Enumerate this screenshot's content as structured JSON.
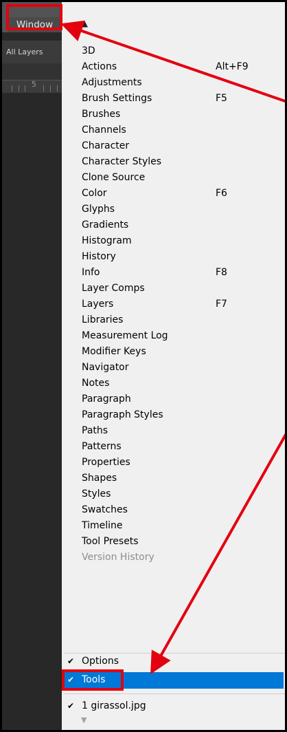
{
  "app": {
    "menubar_item": "Window",
    "layers_label": "All Layers",
    "ruler_number": "5"
  },
  "menu": {
    "items": [
      {
        "label": "3D",
        "shortcut": ""
      },
      {
        "label": "Actions",
        "shortcut": "Alt+F9"
      },
      {
        "label": "Adjustments",
        "shortcut": ""
      },
      {
        "label": "Brush Settings",
        "shortcut": "F5"
      },
      {
        "label": "Brushes",
        "shortcut": ""
      },
      {
        "label": "Channels",
        "shortcut": ""
      },
      {
        "label": "Character",
        "shortcut": ""
      },
      {
        "label": "Character Styles",
        "shortcut": ""
      },
      {
        "label": "Clone Source",
        "shortcut": ""
      },
      {
        "label": "Color",
        "shortcut": "F6"
      },
      {
        "label": "Glyphs",
        "shortcut": ""
      },
      {
        "label": "Gradients",
        "shortcut": ""
      },
      {
        "label": "Histogram",
        "shortcut": ""
      },
      {
        "label": "History",
        "shortcut": ""
      },
      {
        "label": "Info",
        "shortcut": "F8"
      },
      {
        "label": "Layer Comps",
        "shortcut": ""
      },
      {
        "label": "Layers",
        "shortcut": "F7"
      },
      {
        "label": "Libraries",
        "shortcut": ""
      },
      {
        "label": "Measurement Log",
        "shortcut": ""
      },
      {
        "label": "Modifier Keys",
        "shortcut": ""
      },
      {
        "label": "Navigator",
        "shortcut": ""
      },
      {
        "label": "Notes",
        "shortcut": ""
      },
      {
        "label": "Paragraph",
        "shortcut": ""
      },
      {
        "label": "Paragraph Styles",
        "shortcut": ""
      },
      {
        "label": "Paths",
        "shortcut": ""
      },
      {
        "label": "Patterns",
        "shortcut": ""
      },
      {
        "label": "Properties",
        "shortcut": ""
      },
      {
        "label": "Shapes",
        "shortcut": ""
      },
      {
        "label": "Styles",
        "shortcut": ""
      },
      {
        "label": "Swatches",
        "shortcut": ""
      },
      {
        "label": "Timeline",
        "shortcut": ""
      },
      {
        "label": "Tool Presets",
        "shortcut": ""
      },
      {
        "label": "Version History",
        "shortcut": "",
        "disabled": true
      }
    ],
    "options_label": "Options",
    "tools_label": "Tools",
    "document_label": "1 girassol.jpg",
    "check_glyph": "✔",
    "scroll_up_glyph": "▲",
    "scroll_down_glyph": "▼"
  },
  "colors": {
    "highlight_box": "#e3000f",
    "selection": "#0078d7"
  }
}
